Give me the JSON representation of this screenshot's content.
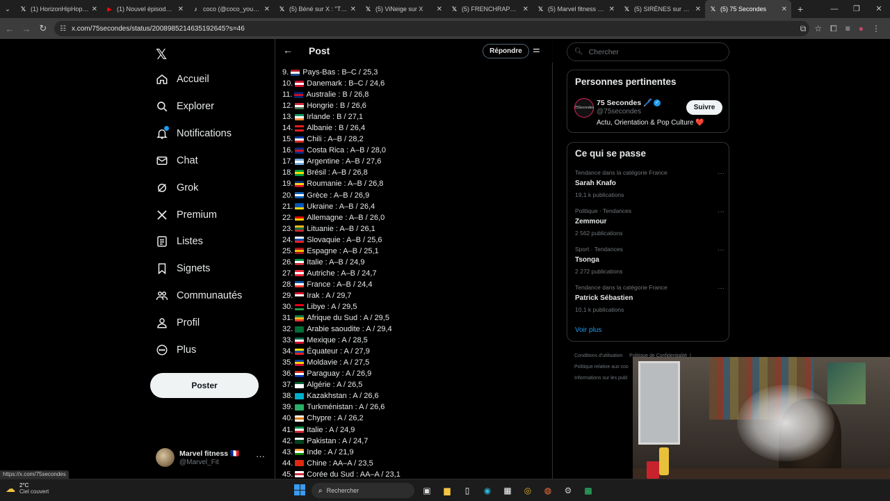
{
  "browser": {
    "tabs": [
      {
        "label": "(1) HorizonHipHop sur X",
        "icon": "x-icon",
        "active": false
      },
      {
        "label": "(1) Nouvel épisode de",
        "icon": "youtube-icon",
        "active": false
      },
      {
        "label": "coco (@coco_yourbabe)",
        "icon": "tiktok-icon",
        "active": false
      },
      {
        "label": "(5) Béné sur X : \"TKT",
        "icon": "x-icon",
        "active": false
      },
      {
        "label": "(5) ViNeige sur X",
        "icon": "x-icon",
        "active": false
      },
      {
        "label": "(5) FRENCHRAPUS sur",
        "icon": "x-icon",
        "active": false
      },
      {
        "label": "(5) Marvel fitness sur",
        "icon": "x-icon",
        "active": false
      },
      {
        "label": "(5) SIRÈNES sur X : \"",
        "icon": "x-icon",
        "active": false
      },
      {
        "label": "(5) 75 Secondes",
        "icon": "x-icon",
        "active": true
      }
    ],
    "url": "x.com/75secondes/status/2008985214635192645?s=46"
  },
  "nav": {
    "items": [
      {
        "label": "Accueil",
        "icon": "home-icon"
      },
      {
        "label": "Explorer",
        "icon": "search-icon"
      },
      {
        "label": "Notifications",
        "icon": "bell-icon"
      },
      {
        "label": "Chat",
        "icon": "mail-icon"
      },
      {
        "label": "Grok",
        "icon": "grok-icon"
      },
      {
        "label": "Premium",
        "icon": "x-icon"
      },
      {
        "label": "Listes",
        "icon": "list-icon"
      },
      {
        "label": "Signets",
        "icon": "bookmark-icon"
      },
      {
        "label": "Communautés",
        "icon": "community-icon"
      },
      {
        "label": "Profil",
        "icon": "user-icon"
      },
      {
        "label": "Plus",
        "icon": "more-icon"
      }
    ],
    "post_label": "Poster",
    "account": {
      "name": "Marvel fitness 🇫🇷",
      "handle": "@Marvel_Fit"
    },
    "status_url": "https://x.com/75secondes"
  },
  "post": {
    "header_title": "Post",
    "reply_label": "Répondre",
    "list": [
      {
        "text": "9. Pays-Bas : B–C / 25,3",
        "colors": [
          "#ae1c28",
          "#ffffff",
          "#21468b"
        ]
      },
      {
        "text": "10. Danemark : B–C / 24,6",
        "colors": [
          "#c8102e",
          "#ffffff",
          "#c8102e"
        ]
      },
      {
        "text": "11. Australie : B / 26,8",
        "colors": [
          "#012169",
          "#c8102e",
          "#012169"
        ]
      },
      {
        "text": "12. Hongrie : B / 26,6",
        "colors": [
          "#ce2939",
          "#ffffff",
          "#477050"
        ]
      },
      {
        "text": "13. Irlande : B / 27,1",
        "colors": [
          "#169b62",
          "#ffffff",
          "#ff883e"
        ]
      },
      {
        "text": "14. Albanie : B / 26,4",
        "colors": [
          "#e41e20",
          "#000000",
          "#e41e20"
        ]
      },
      {
        "text": "15. Chili : A–B / 28,2",
        "colors": [
          "#0039a6",
          "#ffffff",
          "#d52b1e"
        ]
      },
      {
        "text": "16. Costa Rica : A–B / 28,0",
        "colors": [
          "#002b7f",
          "#ce1126",
          "#002b7f"
        ]
      },
      {
        "text": "17. Argentine : A–B / 27,6",
        "colors": [
          "#74acdf",
          "#ffffff",
          "#74acdf"
        ]
      },
      {
        "text": "18. Brésil : A–B / 26,8",
        "colors": [
          "#009b3a",
          "#fedf00",
          "#009b3a"
        ]
      },
      {
        "text": "19. Roumanie : A–B / 26,8",
        "colors": [
          "#002b7f",
          "#fcd116",
          "#ce1126"
        ]
      },
      {
        "text": "20. Grèce : A–B / 26,9",
        "colors": [
          "#0d5eaf",
          "#ffffff",
          "#0d5eaf"
        ]
      },
      {
        "text": "21. Ukraine : A–B / 26,4",
        "colors": [
          "#0057b7",
          "#0057b7",
          "#ffd700"
        ]
      },
      {
        "text": "22. Allemagne : A–B / 26,0",
        "colors": [
          "#000000",
          "#dd0000",
          "#ffce00"
        ]
      },
      {
        "text": "23. Lituanie : A–B / 26,1",
        "colors": [
          "#fdb913",
          "#006a44",
          "#c1272d"
        ]
      },
      {
        "text": "24. Slovaquie : A–B / 25,6",
        "colors": [
          "#ffffff",
          "#0b4ea2",
          "#ee1c25"
        ]
      },
      {
        "text": "25. Espagne : A–B / 25,1",
        "colors": [
          "#aa151b",
          "#f1bf00",
          "#aa151b"
        ]
      },
      {
        "text": "26. Italie : A–B / 24,9",
        "colors": [
          "#009246",
          "#ffffff",
          "#ce2b37"
        ]
      },
      {
        "text": "27. Autriche : A–B / 24,7",
        "colors": [
          "#ed2939",
          "#ffffff",
          "#ed2939"
        ]
      },
      {
        "text": "28. France : A–B / 24,4",
        "colors": [
          "#0055a4",
          "#ffffff",
          "#ef4135"
        ]
      },
      {
        "text": "29. Irak : A / 29,7",
        "colors": [
          "#ce1126",
          "#ffffff",
          "#000000"
        ]
      },
      {
        "text": "30. Libye : A / 29,5",
        "colors": [
          "#e70013",
          "#000000",
          "#239e46"
        ]
      },
      {
        "text": "31. Afrique du Sud : A / 29,5",
        "colors": [
          "#007a4d",
          "#ffb612",
          "#de3831"
        ]
      },
      {
        "text": "32. Arabie saoudite : A / 29,4",
        "colors": [
          "#006c35",
          "#006c35",
          "#006c35"
        ]
      },
      {
        "text": "33. Mexique : A / 28,5",
        "colors": [
          "#006847",
          "#ffffff",
          "#ce1126"
        ]
      },
      {
        "text": "34. Équateur : A / 27,9",
        "colors": [
          "#ffdd00",
          "#034ea2",
          "#ed1c24"
        ]
      },
      {
        "text": "35. Moldavie : A / 27,5",
        "colors": [
          "#003da5",
          "#ffd100",
          "#cc092f"
        ]
      },
      {
        "text": "36. Paraguay : A / 26,9",
        "colors": [
          "#d52b1e",
          "#ffffff",
          "#0038a8"
        ]
      },
      {
        "text": "37. Algérie : A / 26,5",
        "colors": [
          "#006233",
          "#ffffff",
          "#ffffff"
        ]
      },
      {
        "text": "38. Kazakhstan : A / 26,6",
        "colors": [
          "#00afca",
          "#00afca",
          "#00afca"
        ]
      },
      {
        "text": "39. Turkménistan : A / 26,6",
        "colors": [
          "#28ae66",
          "#28ae66",
          "#28ae66"
        ]
      },
      {
        "text": "40. Chypre : A / 26,2",
        "colors": [
          "#ffffff",
          "#d57800",
          "#ffffff"
        ]
      },
      {
        "text": "41. Italie : A / 24,9",
        "colors": [
          "#009246",
          "#ffffff",
          "#ce2b37"
        ]
      },
      {
        "text": "42. Pakistan : A / 24,7",
        "colors": [
          "#ffffff",
          "#01411c",
          "#01411c"
        ]
      },
      {
        "text": "43. Inde : A / 21,9",
        "colors": [
          "#ff9933",
          "#ffffff",
          "#138808"
        ]
      },
      {
        "text": "44. Chine : AA–A / 23,5",
        "colors": [
          "#de2910",
          "#de2910",
          "#de2910"
        ]
      },
      {
        "text": "45. Corée du Sud : AA–A / 23,1",
        "colors": [
          "#ffffff",
          "#cd2e3a",
          "#ffffff"
        ]
      }
    ]
  },
  "sidebar": {
    "search_placeholder": "Chercher",
    "relevant": {
      "title": "Personnes pertinentes",
      "name": "75 Secondes 🖊️",
      "handle": "@75secondes",
      "bio": "Actu, Orientation & Pop Culture ❤️",
      "follow_label": "Suivre",
      "avatar_text": "75Secondes"
    },
    "trends": {
      "title": "Ce qui se passe",
      "items": [
        {
          "category": "Tendance dans la catégorie France",
          "name": "Sarah Knafo",
          "count": "19,1 k publications"
        },
        {
          "category": "Politique · Tendances",
          "name": "Zemmour",
          "count": "2 562 publications"
        },
        {
          "category": "Sport · Tendances",
          "name": "Tsonga",
          "count": "2 272 publications"
        },
        {
          "category": "Tendance dans la catégorie France",
          "name": "Patrick Sébastien",
          "count": "10,1 k publications"
        }
      ],
      "see_more": "Voir plus"
    },
    "footer": [
      "Conditions d'utilisation",
      "Politique de Confidentialité",
      "|",
      "Politique relative aux coo",
      "Informations sur les publ"
    ]
  },
  "taskbar": {
    "temp": "2°C",
    "weather": "Ciel couvert",
    "search_label": "Rechercher"
  }
}
